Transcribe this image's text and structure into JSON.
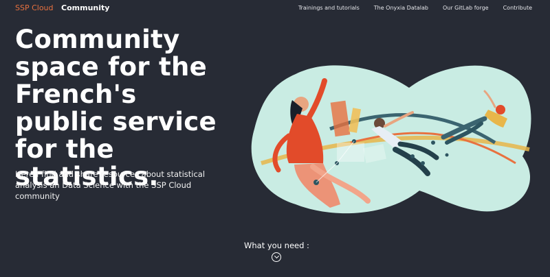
{
  "header": {
    "brand_primary": "SSP Cloud",
    "brand_secondary": "Community",
    "nav": [
      {
        "label": "Trainings and tutorials"
      },
      {
        "label": "The Onyxia Datalab"
      },
      {
        "label": "Our GitLab forge"
      },
      {
        "label": "Contribute"
      }
    ]
  },
  "hero": {
    "title": "Community space for the French's public service for the statistics.",
    "description": "Here I find and share resources about statistical analysis an Data Science with the SSP Cloud community"
  },
  "footer_prompt": {
    "label": "What you need :",
    "icon": "chevron-down-icon"
  },
  "colors": {
    "background": "#272b35",
    "accent": "#e8713f",
    "blob": "#c9ece3"
  }
}
